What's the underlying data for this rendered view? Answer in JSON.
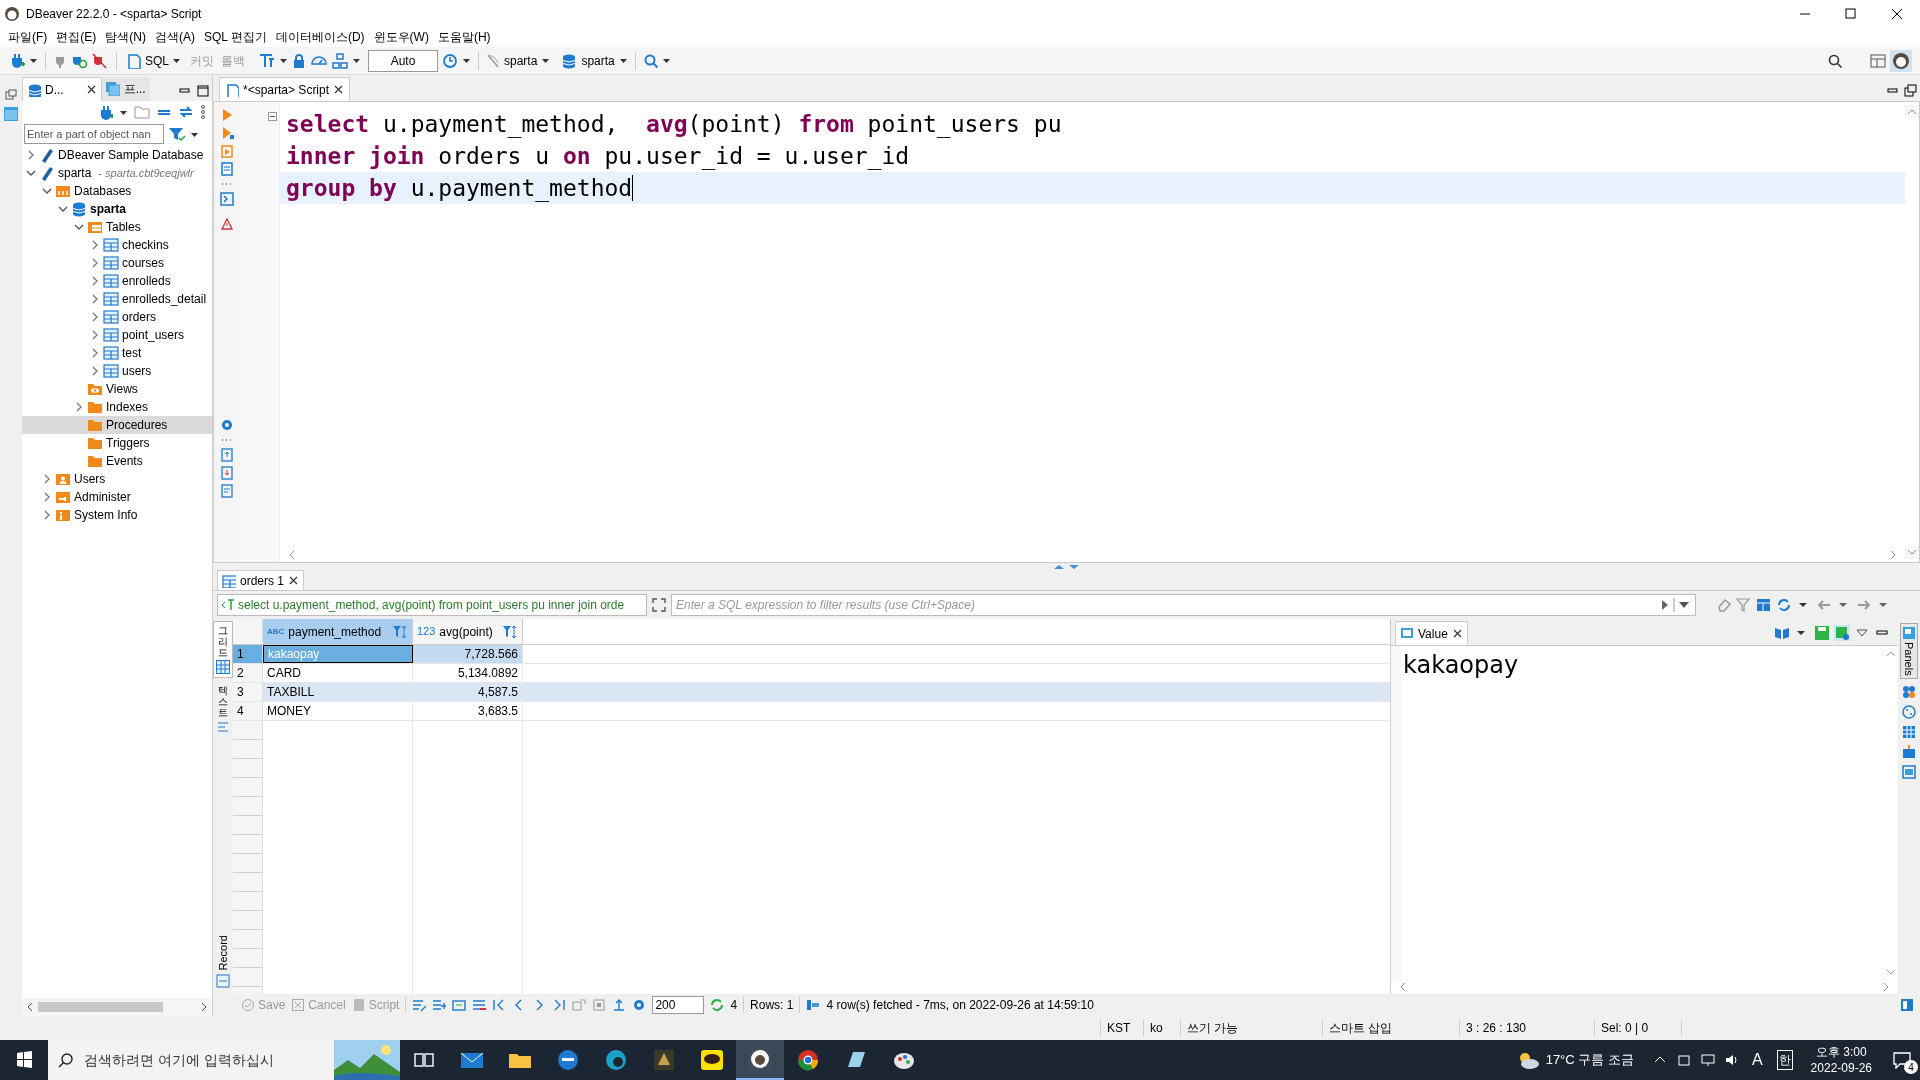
{
  "window": {
    "title": "DBeaver 22.2.0 - <sparta> Script"
  },
  "menu": [
    "파일(F)",
    "편집(E)",
    "탐색(N)",
    "검색(A)",
    "SQL 편집기",
    "데이터베이스(D)",
    "윈도우(W)",
    "도움말(H)"
  ],
  "toolbar": {
    "sql": "SQL",
    "commit": "커밋",
    "rollback": "롤백",
    "mode": "Auto",
    "connection": "sparta",
    "schema": "sparta"
  },
  "navigator": {
    "tabs": [
      {
        "label": "D...",
        "selected": true
      },
      {
        "label": "프...",
        "selected": false
      }
    ],
    "filter": {
      "placeholder": "Enter a part of object nan"
    },
    "tree": [
      {
        "label": "DBeaver Sample Database",
        "kind": "connection",
        "expandable": true,
        "expanded": false,
        "selected": false
      },
      {
        "label": "sparta",
        "note": "- sparta.cbt9ceqjwlr",
        "kind": "connection",
        "expandable": true,
        "expanded": true,
        "selected": false,
        "children": [
          {
            "label": "Databases",
            "kind": "folder-db",
            "expandable": true,
            "expanded": true,
            "selected": false,
            "children": [
              {
                "label": "sparta",
                "kind": "database",
                "bold": true,
                "expandable": true,
                "expanded": true,
                "selected": false,
                "children": [
                  {
                    "label": "Tables",
                    "kind": "tables",
                    "expandable": true,
                    "expanded": true,
                    "selected": false,
                    "children": [
                      {
                        "label": "checkins",
                        "kind": "table",
                        "expandable": true,
                        "expanded": false,
                        "selected": false
                      },
                      {
                        "label": "courses",
                        "kind": "table",
                        "expandable": true,
                        "expanded": false,
                        "selected": false
                      },
                      {
                        "label": "enrolleds",
                        "kind": "table",
                        "expandable": true,
                        "expanded": false,
                        "selected": false
                      },
                      {
                        "label": "enrolleds_detail",
                        "kind": "table",
                        "expandable": true,
                        "expanded": false,
                        "selected": false
                      },
                      {
                        "label": "orders",
                        "kind": "table",
                        "expandable": true,
                        "expanded": false,
                        "selected": false
                      },
                      {
                        "label": "point_users",
                        "kind": "table",
                        "expandable": true,
                        "expanded": false,
                        "selected": false
                      },
                      {
                        "label": "test",
                        "kind": "table",
                        "expandable": true,
                        "expanded": false,
                        "selected": false
                      },
                      {
                        "label": "users",
                        "kind": "table",
                        "expandable": true,
                        "expanded": false,
                        "selected": false
                      }
                    ]
                  },
                  {
                    "label": "Views",
                    "kind": "views",
                    "expandable": false,
                    "selected": false
                  },
                  {
                    "label": "Indexes",
                    "kind": "folder",
                    "expandable": true,
                    "expanded": false,
                    "selected": false
                  },
                  {
                    "label": "Procedures",
                    "kind": "folder",
                    "expandable": false,
                    "selected": true
                  },
                  {
                    "label": "Triggers",
                    "kind": "folder",
                    "expandable": false,
                    "selected": false
                  },
                  {
                    "label": "Events",
                    "kind": "folder",
                    "expandable": false,
                    "selected": false
                  }
                ]
              }
            ]
          },
          {
            "label": "Users",
            "kind": "users",
            "expandable": true,
            "expanded": false,
            "selected": false
          },
          {
            "label": "Administer",
            "kind": "admin",
            "expandable": true,
            "expanded": false,
            "selected": false
          },
          {
            "label": "System Info",
            "kind": "info",
            "expandable": true,
            "expanded": false,
            "selected": false
          }
        ]
      }
    ]
  },
  "editor": {
    "tab": "*<sparta> Script",
    "lines": [
      {
        "current": false,
        "tokens": [
          {
            "t": "select",
            "kind": "keyword"
          },
          {
            "t": " u.payment_method,  ",
            "kind": "plain"
          },
          {
            "t": "avg",
            "kind": "keyword"
          },
          {
            "t": "(point) ",
            "kind": "plain"
          },
          {
            "t": "from",
            "kind": "keyword"
          },
          {
            "t": " point_users pu",
            "kind": "plain"
          }
        ]
      },
      {
        "current": false,
        "tokens": [
          {
            "t": "inner join",
            "kind": "keyword"
          },
          {
            "t": " orders u ",
            "kind": "plain"
          },
          {
            "t": "on",
            "kind": "keyword"
          },
          {
            "t": " pu.user_id = u.user_id",
            "kind": "plain"
          }
        ]
      },
      {
        "current": true,
        "tokens": [
          {
            "t": "group by",
            "kind": "keyword"
          },
          {
            "t": " u.payment_method",
            "kind": "plain"
          }
        ]
      }
    ]
  },
  "results": {
    "tab": "orders 1",
    "query": "select u.payment_method, avg(point) from point_users pu inner join orde",
    "filter": {
      "placeholder": "Enter a SQL expression to filter results (use Ctrl+Space)"
    },
    "side_tabs": [
      {
        "label": "그리드",
        "selected": true
      },
      {
        "label": "텍스트",
        "selected": false
      }
    ],
    "record": "Record",
    "columns": [
      {
        "type": "ABC",
        "label": "payment_method",
        "kind": "text"
      },
      {
        "type": "123",
        "label": "avg(point)",
        "kind": "number"
      }
    ],
    "rows": [
      {
        "number": "1",
        "cells": [
          "kakaopay",
          "7,728.566"
        ],
        "selected": true,
        "hovered": false
      },
      {
        "number": "2",
        "cells": [
          "CARD",
          "5,134.0892"
        ],
        "selected": false,
        "hovered": false
      },
      {
        "number": "3",
        "cells": [
          "TAXBILL",
          "4,587.5"
        ],
        "selected": false,
        "hovered": true
      },
      {
        "number": "4",
        "cells": [
          "MONEY",
          "3,683.5"
        ],
        "selected": false,
        "hovered": false
      }
    ],
    "value_panel": {
      "tab": "Value",
      "value": "kakaopay",
      "panels": "Panels"
    },
    "bottom": {
      "save": "Save",
      "cancel": "Cancel",
      "script": "Script",
      "fetch_size": "200",
      "count": "4",
      "rows": "Rows: 1",
      "message": "4 row(s) fetched - 7ms, on 2022-09-26 at 14:59:10"
    }
  },
  "status_bar": [
    "KST",
    "ko",
    "쓰기 가능",
    "스마트 삽입",
    "3 : 26 : 130",
    "Sel: 0 | 0"
  ],
  "taskbar": {
    "search": {
      "placeholder": "검색하려면 여기에 입력하십시"
    },
    "weather": "17°C 구름 조금",
    "ime_a": "A",
    "ime_han": "한",
    "time": "오후 3:00",
    "date": "2022-09-26",
    "notifications": "4"
  }
}
